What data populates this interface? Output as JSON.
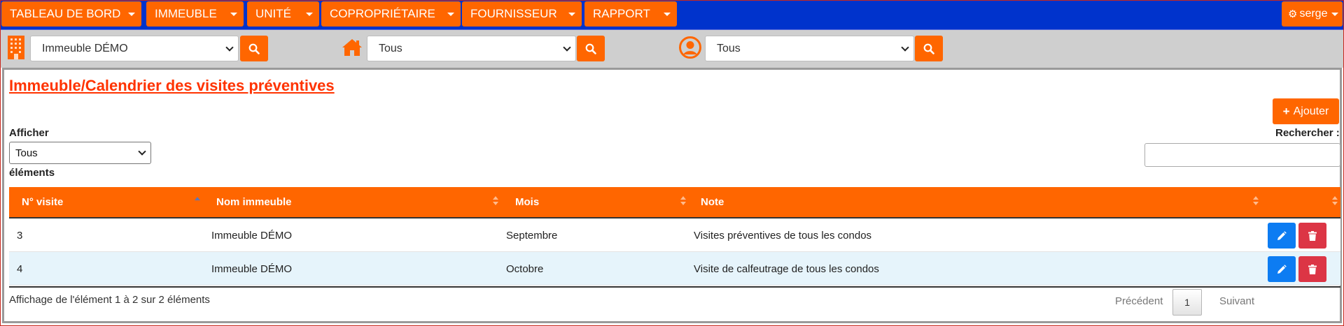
{
  "nav": {
    "items": [
      {
        "label": "TABLEAU DE BORD"
      },
      {
        "label": "IMMEUBLE"
      },
      {
        "label": "UNITÉ"
      },
      {
        "label": "COPROPRIÉTAIRE"
      },
      {
        "label": "FOURNISSEUR"
      },
      {
        "label": "RAPPORT"
      }
    ],
    "user": "serge"
  },
  "filters": {
    "building": {
      "value": "Immeuble DÉMO",
      "icon": "building-icon"
    },
    "unit": {
      "value": "Tous",
      "icon": "home-icon"
    },
    "owner": {
      "value": "Tous",
      "icon": "user-circle-icon"
    }
  },
  "page": {
    "title": "Immeuble/Calendrier des visites préventives",
    "add_label": "Ajouter",
    "show_label": "Afficher",
    "show_value": "Tous",
    "elements_label": "éléments",
    "search_label": "Rechercher :",
    "search_value": ""
  },
  "table": {
    "columns": [
      "N° visite",
      "Nom immeuble",
      "Mois",
      "Note"
    ],
    "rows": [
      {
        "num": "3",
        "building": "Immeuble DÉMO",
        "month": "Septembre",
        "note": "Visites préventives de tous les condos"
      },
      {
        "num": "4",
        "building": "Immeuble DÉMO",
        "month": "Octobre",
        "note": "Visite de calfeutrage de tous les condos"
      }
    ]
  },
  "footer": {
    "info": "Affichage de l'élément 1 à 2 sur 2 éléments",
    "previous": "Précédent",
    "page": "1",
    "next": "Suivant"
  },
  "colors": {
    "accent": "#ff6600",
    "nav_bg": "#0033cc",
    "title": "#ff3300",
    "edit": "#0d7cf2",
    "delete": "#dc3545",
    "row_alt": "#e6f4fb"
  }
}
